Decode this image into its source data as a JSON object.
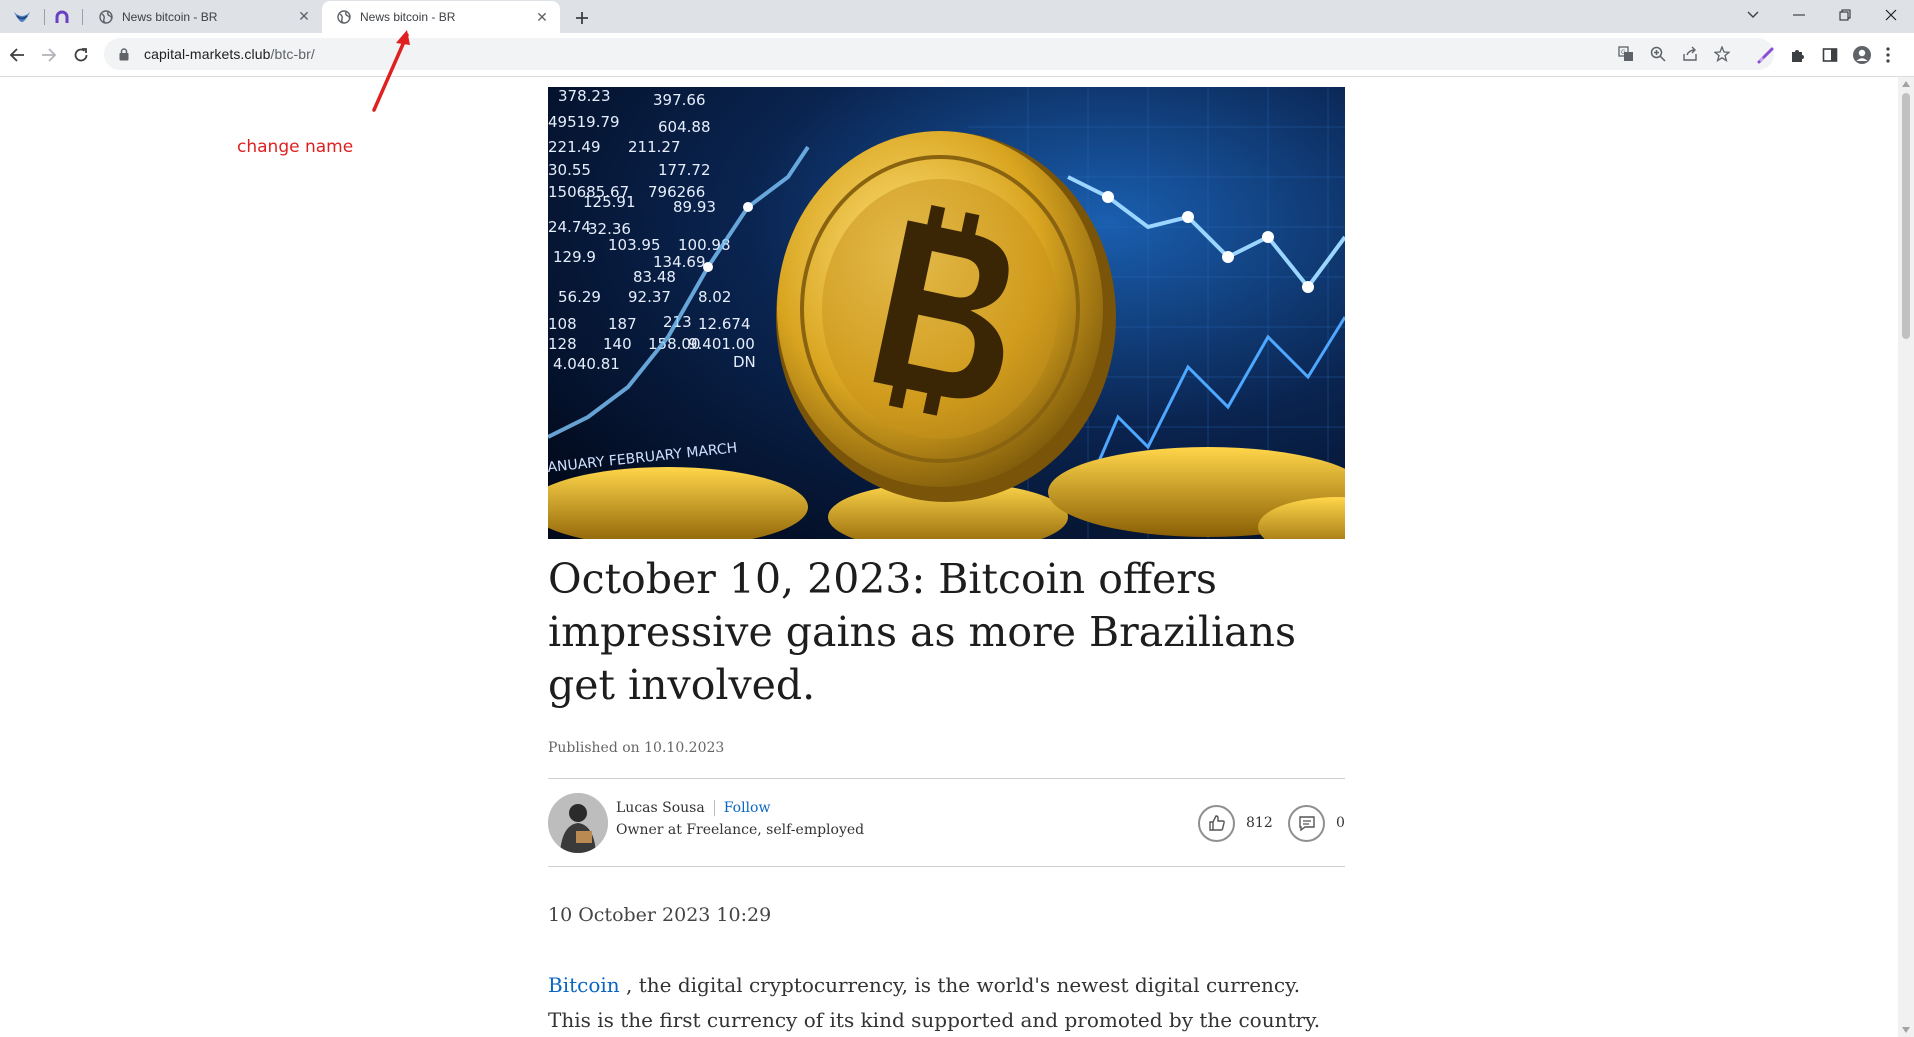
{
  "browser": {
    "tabs": [
      {
        "title": "News bitcoin - BR",
        "active": false
      },
      {
        "title": "News bitcoin - BR",
        "active": true
      }
    ],
    "url_host": "capital-markets.club",
    "url_path": "/btc-br/"
  },
  "annotation": {
    "text": "change name",
    "color": "#e02020"
  },
  "article": {
    "headline": "October 10, 2023: Bitcoin offers impressive gains as more Brazilians get involved.",
    "published": "Published on 10.10.2023",
    "author_name": "Lucas Sousa",
    "follow_label": "Follow",
    "author_title": "Owner at Freelance, self-employed",
    "likes": "812",
    "comments": "0",
    "datetime": "10 October 2023 10:29",
    "body_link": "Bitcoin",
    "body_text": " , the digital cryptocurrency, is the world's newest digital currency. This is the first currency of its kind supported and promoted by the country."
  },
  "hero_ticker_numbers": [
    "378.23",
    "397.66",
    "49519.79",
    "604.88",
    "221.49",
    "211.27",
    "30.55",
    "177.72",
    "150685.67",
    "796266",
    "125.91",
    "89.93",
    "24.74",
    "32.36",
    "103.95",
    "100.98",
    "129.9",
    "134.69",
    "83.48",
    "56.29",
    "92.37",
    "8.02",
    "108",
    "187",
    "213",
    "12.674",
    "128",
    "140",
    "158.00",
    "9.401.00",
    "4.040.81",
    "DN"
  ],
  "hero_month_labels": "ANUARY FEBRUARY MARCH",
  "colors": {
    "link": "#0a66c2",
    "tab_bg": "#dee1e6"
  }
}
